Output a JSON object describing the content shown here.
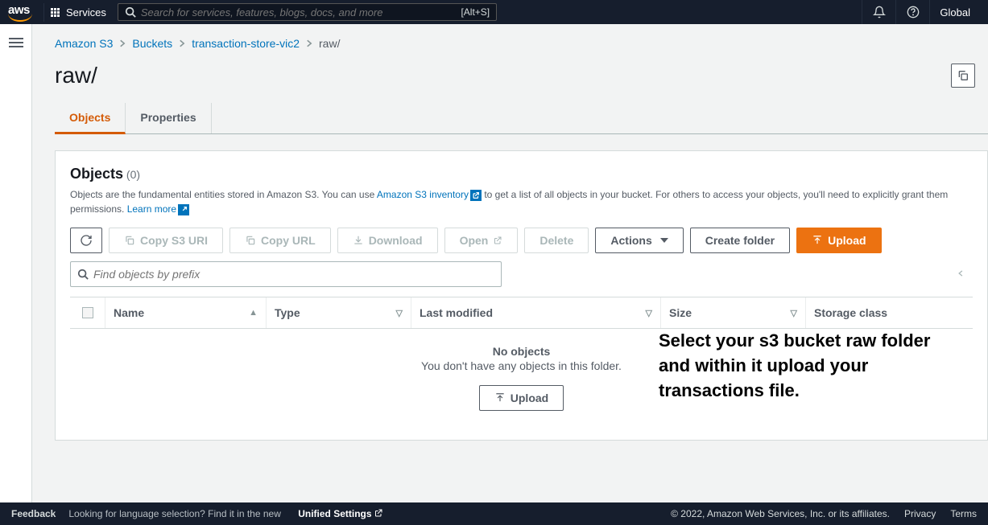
{
  "nav": {
    "services_label": "Services",
    "search_placeholder": "Search for services, features, blogs, docs, and more",
    "search_shortcut": "[Alt+S]",
    "region_label": "Global"
  },
  "breadcrumbs": {
    "items": [
      "Amazon S3",
      "Buckets",
      "transaction-store-vic2"
    ],
    "current": "raw/"
  },
  "page_title": "raw/",
  "tabs": {
    "objects": "Objects",
    "properties": "Properties"
  },
  "panel": {
    "title": "Objects",
    "count": "(0)",
    "desc_pre": "Objects are the fundamental entities stored in Amazon S3. You can use ",
    "inventory_link": "Amazon S3 inventory",
    "desc_mid": " to get a list of all objects in your bucket. For others to access your objects, you'll need to explicitly grant them permissions. ",
    "learn_more": "Learn more"
  },
  "toolbar": {
    "copy_uri": "Copy S3 URI",
    "copy_url": "Copy URL",
    "download": "Download",
    "open": "Open",
    "delete": "Delete",
    "actions": "Actions",
    "create_folder": "Create folder",
    "upload": "Upload"
  },
  "filter": {
    "placeholder": "Find objects by prefix"
  },
  "table": {
    "headers": {
      "name": "Name",
      "type": "Type",
      "modified": "Last modified",
      "size": "Size",
      "storage": "Storage class"
    },
    "empty_title": "No objects",
    "empty_sub": "You don't have any objects in this folder.",
    "empty_upload": "Upload"
  },
  "annotation": "Select your s3 bucket raw folder and within it upload your transactions file.",
  "footer": {
    "feedback": "Feedback",
    "lang_hint": "Looking for language selection? Find it in the new ",
    "unified": "Unified Settings",
    "copyright": "© 2022, Amazon Web Services, Inc. or its affiliates.",
    "privacy": "Privacy",
    "terms": "Terms"
  }
}
